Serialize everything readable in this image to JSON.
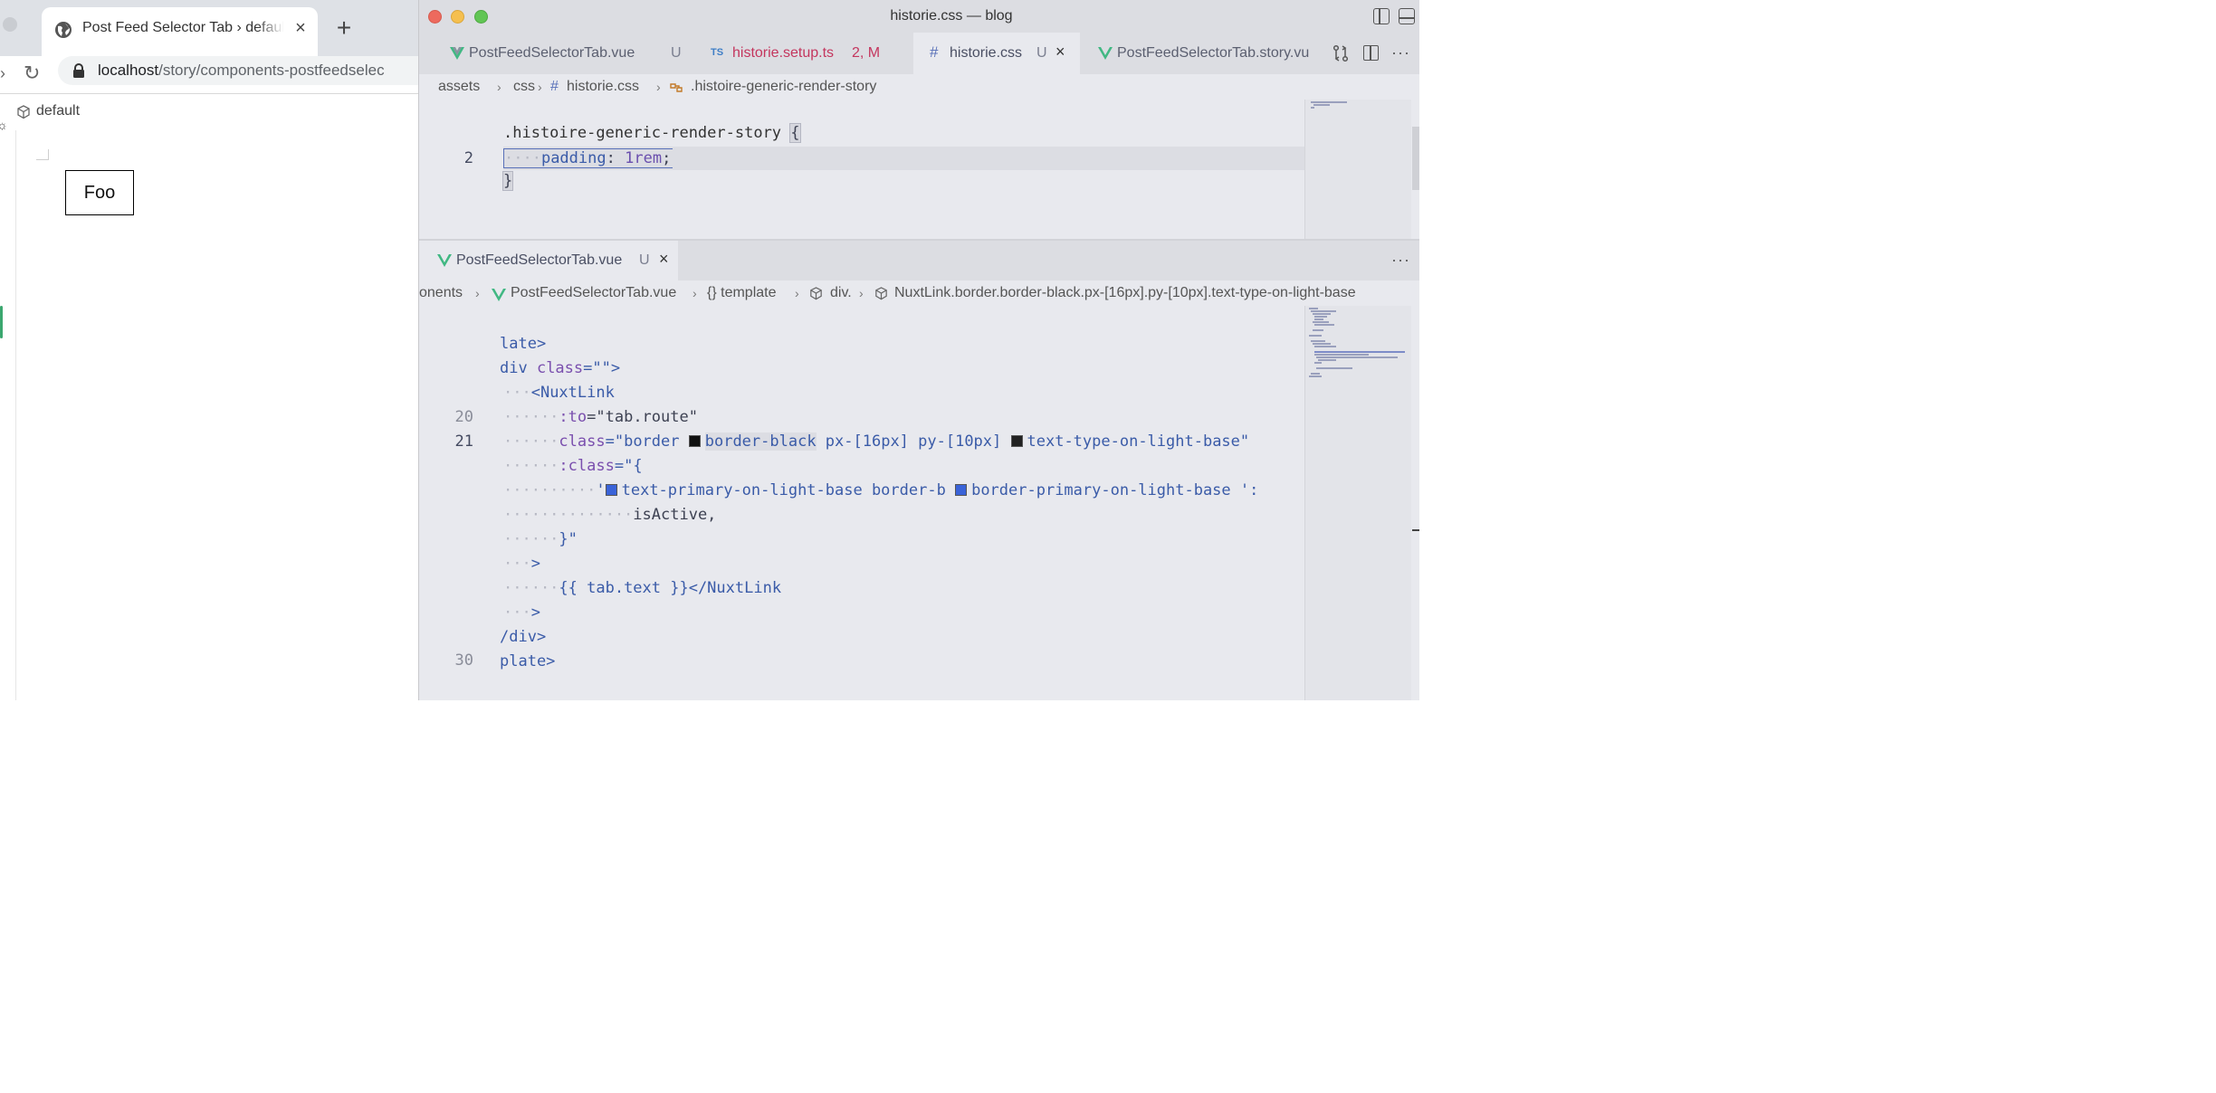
{
  "browser": {
    "tab_title": "Post Feed Selector Tab › default",
    "tab_close": "×",
    "new_tab": "+",
    "url_host": "localhost",
    "url_path": "/story/components-postfeedselec",
    "variant_label": "default",
    "preview_button": "Foo"
  },
  "vscode": {
    "window_title": "historie.css — blog",
    "tabs": [
      {
        "label": "PostFeedSelectorTab.vue",
        "badge": "U",
        "icon": "vue-icon"
      },
      {
        "label": "historie.setup.ts",
        "badge": "2, M",
        "icon": "ts-icon",
        "icon_text": "TS"
      },
      {
        "label": "historie.css",
        "badge": "U",
        "icon": "hash-icon",
        "icon_text": "#",
        "close": "×"
      },
      {
        "label": "PostFeedSelectorTab.story.vu",
        "icon": "vue-icon"
      }
    ],
    "top_breadcrumb": [
      "assets",
      "css",
      "historie.css",
      ".histoire-generic-render-story"
    ],
    "top_breadcrumb_hash": "#",
    "top_code": {
      "line_numbers": [
        "2"
      ],
      "lines": [
        {
          "selector": ".histoire-generic-render-story",
          "brace": "{"
        },
        {
          "dots": "····",
          "prop": "padding",
          "colon": ":",
          "value": "1rem",
          "semi": ";"
        },
        {
          "brace": "}"
        }
      ]
    },
    "bottom_tab": {
      "label": "PostFeedSelectorTab.vue",
      "badge": "U",
      "close": "×"
    },
    "more": "···",
    "bottom_breadcrumb": [
      "onents",
      "PostFeedSelectorTab.vue",
      "{} template",
      "div.",
      "NuxtLink.border.border-black.px-[16px].py-[10px].text-type-on-light-base"
    ],
    "bottom_code": {
      "line_numbers": {
        "l20": "20",
        "l21": "21",
        "l30": "30"
      },
      "l1": "late>",
      "l2a": "div ",
      "l2b": "class",
      "l2c": "=\"\">",
      "l3d": "···",
      "l3": "<NuxtLink",
      "l4d": "······",
      "l4a": ":to",
      "l4b": "=\"tab.route\"",
      "l5d": "······",
      "l5a": "class",
      "l5b": "=\"border ",
      "l5c": "border-black",
      "l5e": " px-[16px] py-[10px] ",
      "l5f": "text-type-on-light-base\"",
      "l6d": "······",
      "l6a": ":class",
      "l6b": "=\"{",
      "l7d": "··········",
      "l7a": "'",
      "l7b": "text-primary-on-light-base border-b ",
      "l7c": "border-primary-on-light-base ':",
      "l8d": "··············",
      "l8": "isActive,",
      "l9d": "······",
      "l9": "}\"",
      "l10d": "···",
      "l10": ">",
      "l11d": "······",
      "l11": "{{ tab.text }}</NuxtLink",
      "l12d": "···",
      "l12": ">",
      "l13": "/div>",
      "l14": "plate>"
    },
    "colors": {
      "swatch_black": "#111111",
      "swatch_blue": "#3a63d8",
      "tag": "#3a5ba8"
    }
  }
}
